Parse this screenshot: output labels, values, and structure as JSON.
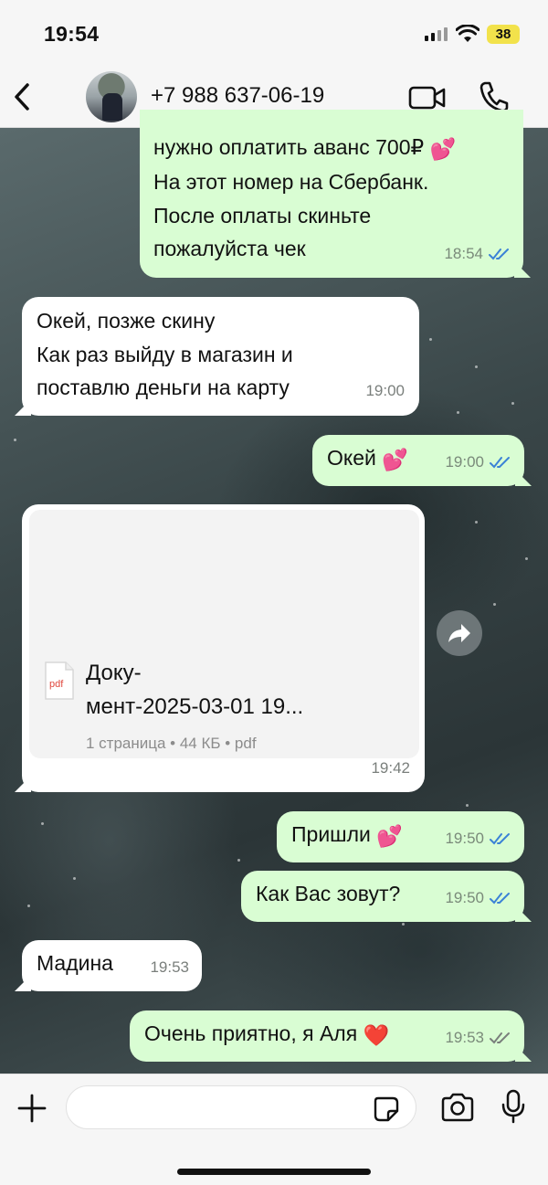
{
  "status_bar": {
    "time": "19:54",
    "battery": "38"
  },
  "header": {
    "contact": "+7 988 637-06-19"
  },
  "messages": [
    {
      "dir": "out",
      "lines": [
        "нужно оплатить аванс 700₽",
        "На этот номер на Сбербанк.",
        "После оплаты скиньте",
        "пожалуйста чек"
      ],
      "emoji": "💕",
      "time": "18:54",
      "status": "read"
    },
    {
      "dir": "in",
      "lines": [
        "Окей, позже скину",
        "Как раз выйду в магазин и",
        "поставлю деньги на карту"
      ],
      "time": "19:00"
    },
    {
      "dir": "out",
      "text": "Окей",
      "emoji": "💕",
      "time": "19:00",
      "status": "read"
    },
    {
      "dir": "in",
      "type": "document",
      "doc_icon_label": "pdf",
      "doc_name_1": "Доку-",
      "doc_name_2": "мент-2025-03-01 19...",
      "doc_info": "1 страница • 44 КБ • pdf",
      "time": "19:42"
    },
    {
      "dir": "out",
      "text": "Пришли",
      "emoji": "💕",
      "time": "19:50",
      "status": "read"
    },
    {
      "dir": "out",
      "text": "Как Вас зовут?",
      "time": "19:50",
      "status": "read"
    },
    {
      "dir": "in",
      "text": "Мадина",
      "time": "19:53"
    },
    {
      "dir": "out",
      "text": "Очень приятно, я Аля",
      "emoji": "❤️",
      "time": "19:53",
      "status": "delivered"
    }
  ],
  "colors": {
    "outgoing_bubble": "#d9fdd3",
    "incoming_bubble": "#ffffff",
    "read_ticks": "#3b82d6",
    "delivered_ticks": "#7a7f7c"
  },
  "icons": [
    "back-chevron-icon",
    "video-call-icon",
    "phone-icon",
    "pdf-icon",
    "forward-icon",
    "plus-icon",
    "sticker-icon",
    "camera-icon",
    "microphone-icon"
  ]
}
